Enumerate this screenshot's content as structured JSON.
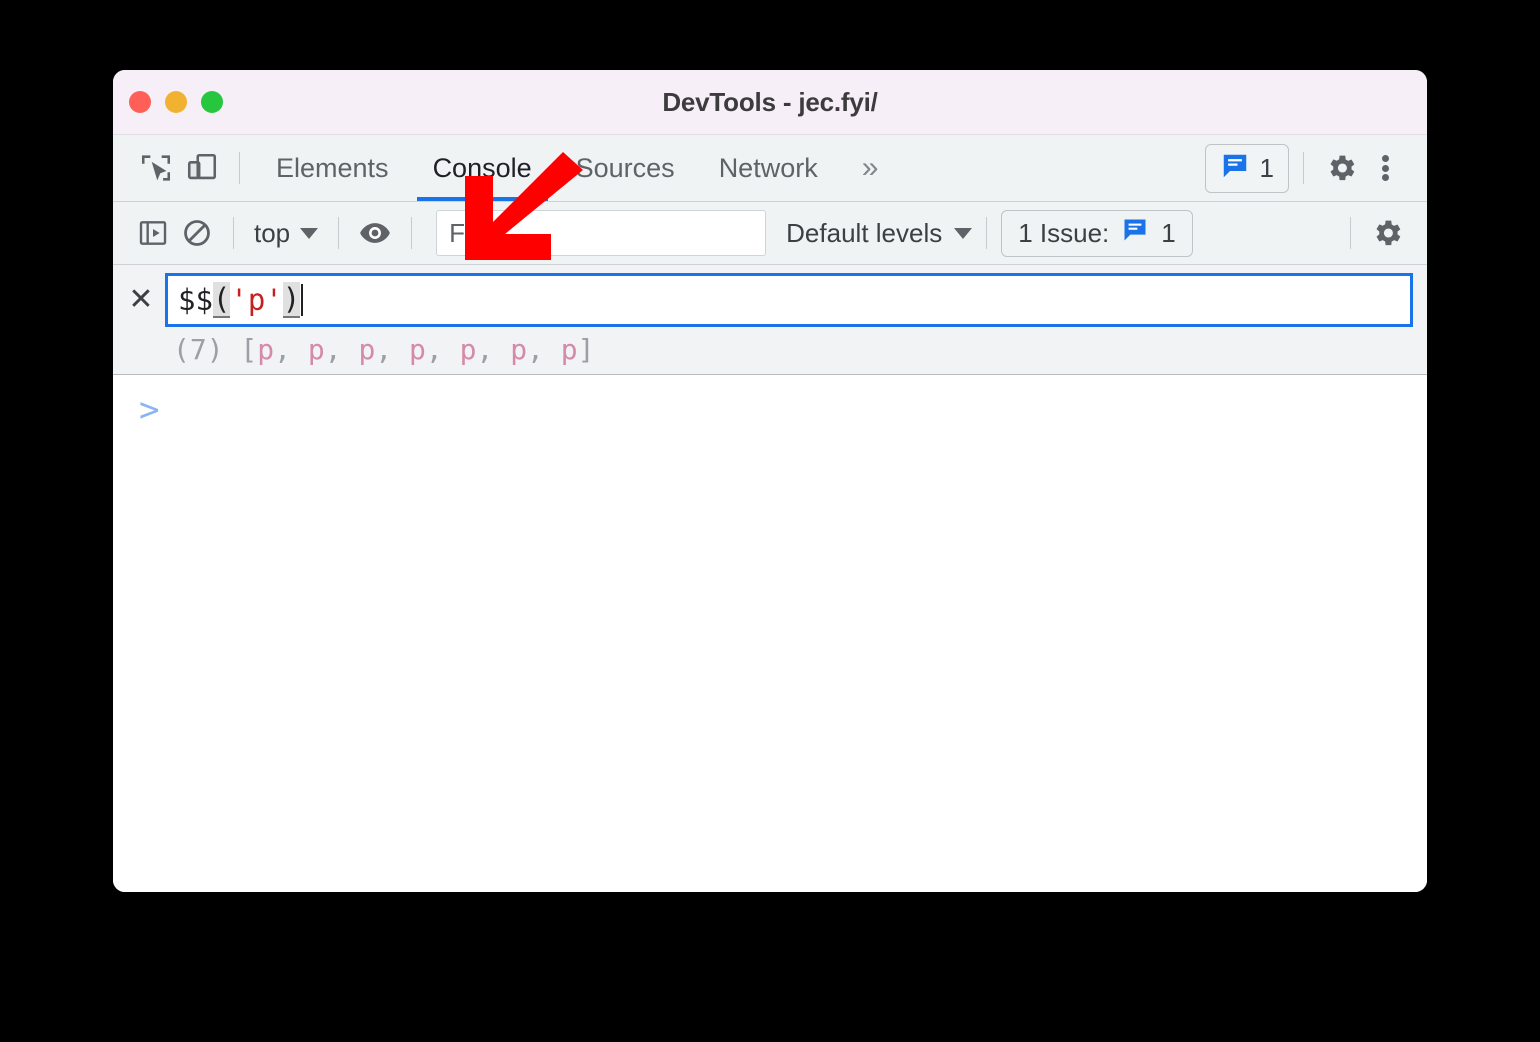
{
  "window": {
    "title": "DevTools - jec.fyi/",
    "traffic_lights": [
      {
        "name": "close",
        "color": "#ff5f57"
      },
      {
        "name": "minimize",
        "color": "#f2b231"
      },
      {
        "name": "zoom",
        "color": "#26c73f"
      }
    ]
  },
  "tabbar": {
    "inspect_icon": "inspect-element-icon",
    "device_icon": "device-toolbar-icon",
    "tabs": [
      {
        "label": "Elements",
        "active": false
      },
      {
        "label": "Console",
        "active": true
      },
      {
        "label": "Sources",
        "active": false
      },
      {
        "label": "Network",
        "active": false
      }
    ],
    "more_tabs_label": "»",
    "issues_badge": {
      "icon": "issue-bubble-icon",
      "count": "1"
    },
    "settings_icon": "gear-icon",
    "menu_icon": "kebab-menu-icon"
  },
  "console_toolbar": {
    "sidebar_toggle_icon": "console-sidebar-toggle-icon",
    "clear_icon": "clear-console-icon",
    "context_selector": "top",
    "eye_icon": "live-expression-eye-icon",
    "filter_placeholder": "Filter",
    "filter_value": "",
    "levels_label": "Default levels",
    "issues_label": "1 Issue:",
    "issues_count": "1",
    "settings_icon": "console-settings-gear-icon"
  },
  "console": {
    "clear_entry_icon": "close-x-icon",
    "input": {
      "tokens": [
        {
          "text": "$$",
          "type": "plain"
        },
        {
          "text": "(",
          "type": "paren"
        },
        {
          "text": "'p'",
          "type": "string"
        },
        {
          "text": ")",
          "type": "paren"
        }
      ],
      "full_text": "$$('p')"
    },
    "result": {
      "length_label": "(7)",
      "open_bracket": " [",
      "nodes": [
        "p",
        "p",
        "p",
        "p",
        "p",
        "p",
        "p"
      ],
      "separator": ", ",
      "close_bracket": "]",
      "full_text": "(7) [p, p, p, p, p, p, p]"
    },
    "prompt_caret": ">"
  },
  "annotation": {
    "arrow": "red-arrow-pointing-down-left",
    "color": "#ff0000"
  },
  "colors": {
    "accent_blue": "#1a73e8",
    "titlebar_bg": "#f7eff7",
    "toolbar_bg": "#eff3f4",
    "string_red": "#c5221f",
    "node_pink": "#d48aa8",
    "prompt_blue": "#8ab4f8"
  }
}
